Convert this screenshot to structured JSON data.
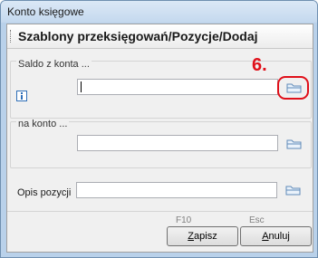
{
  "window": {
    "title": "Konto księgowe"
  },
  "header": {
    "title": "Szablony przeksięgowań/Pozycje/Dodaj"
  },
  "groups": {
    "saldo": {
      "label": "Saldo z konta ...",
      "value": "",
      "info_icon": "info-icon",
      "browse_icon": "folder-icon"
    },
    "na_konto": {
      "label": "na konto ...",
      "value": "",
      "browse_icon": "folder-icon"
    }
  },
  "opis": {
    "label": "Opis pozycji",
    "value": "",
    "browse_icon": "folder-icon"
  },
  "annotation": {
    "number": "6.",
    "color": "#e0101a"
  },
  "buttons": {
    "save": {
      "hotkey": "F10",
      "mnemonic": "Z",
      "rest": "apisz"
    },
    "cancel": {
      "hotkey": "Esc",
      "mnemonic": "A",
      "rest": "nuluj"
    }
  }
}
